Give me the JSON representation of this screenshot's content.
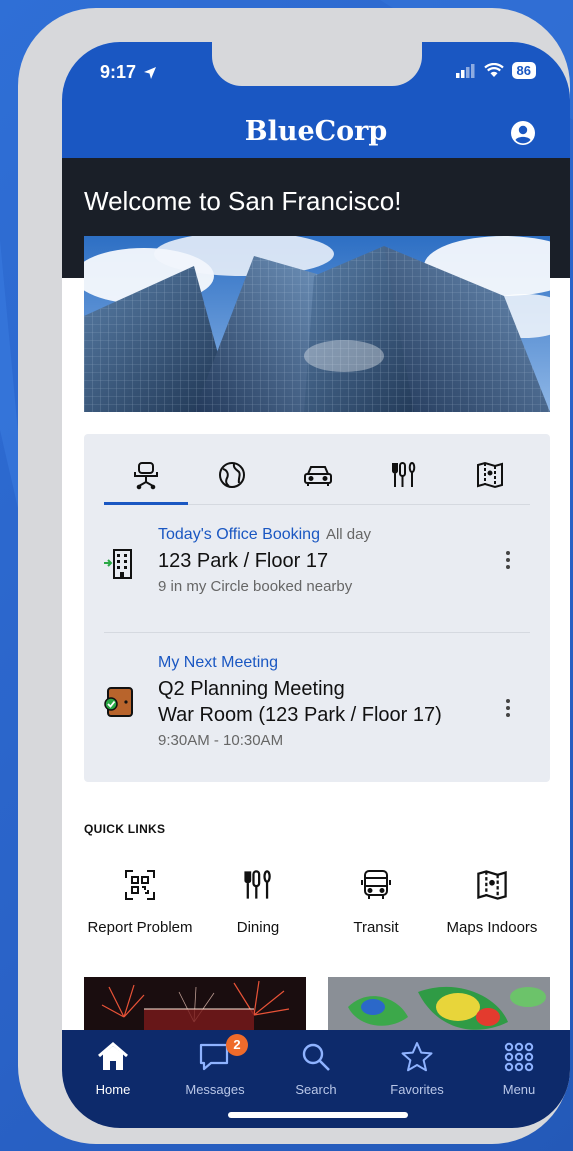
{
  "status_bar": {
    "time": "9:17",
    "battery": "86"
  },
  "header": {
    "brand": "BlueCorp"
  },
  "hero": {
    "welcome": "Welcome to San Francisco!"
  },
  "tabs": [
    {
      "icon": "desk-chair-icon",
      "active": true
    },
    {
      "icon": "globe-icon",
      "active": false
    },
    {
      "icon": "car-icon",
      "active": false
    },
    {
      "icon": "dining-icon",
      "active": false
    },
    {
      "icon": "map-icon",
      "active": false
    }
  ],
  "booking": {
    "eyebrow": "Today's Office Booking",
    "when": "All day",
    "location": "123 Park / Floor 17",
    "detail": "9 in my Circle booked nearby",
    "icon": "office-building-icon"
  },
  "meeting": {
    "eyebrow": "My Next Meeting",
    "title": "Q2 Planning Meeting",
    "room": "War Room (123 Park / Floor 17)",
    "time": "9:30AM - 10:30AM",
    "icon": "door-icon"
  },
  "quick_links": {
    "title": "QUICK LINKS",
    "items": [
      {
        "label": "Report Problem",
        "icon": "qr-code-icon"
      },
      {
        "label": "Dining",
        "icon": "dining-icon"
      },
      {
        "label": "Transit",
        "icon": "bus-icon"
      },
      {
        "label": "Maps Indoors",
        "icon": "map-icon"
      }
    ]
  },
  "tab_bar": {
    "items": [
      {
        "label": "Home",
        "icon": "home-icon",
        "active": true
      },
      {
        "label": "Messages",
        "icon": "chat-icon",
        "badge": "2"
      },
      {
        "label": "Search",
        "icon": "search-icon"
      },
      {
        "label": "Favorites",
        "icon": "star-icon"
      },
      {
        "label": "Menu",
        "icon": "grid-menu-icon"
      }
    ]
  },
  "colors": {
    "brand_blue": "#1a57c2",
    "tab_bar": "#0d2a6b",
    "badge": "#ef6b2b",
    "card_bg": "#e9ecf2"
  }
}
